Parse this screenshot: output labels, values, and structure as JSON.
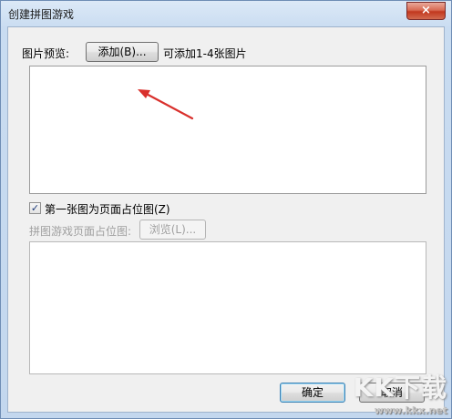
{
  "window": {
    "title": "创建拼图游戏",
    "close_glyph": "×"
  },
  "images_row": {
    "label": "图片预览:",
    "add_button": "添加(B)...",
    "hint": "可添加1-4张图片"
  },
  "first_as_placeholder": {
    "checked": true,
    "check_glyph": "✓",
    "label": "第一张图为页面占位图(Z)"
  },
  "placeholder_row": {
    "label": "拼图游戏页面占位图:",
    "browse_button": "浏览(L)..."
  },
  "footer": {
    "ok_button": "确定",
    "cancel_button": "取消"
  },
  "watermark": {
    "logo": "KK下载",
    "url": "www.kkx.net"
  },
  "colors": {
    "arrow": "#d9302c"
  }
}
